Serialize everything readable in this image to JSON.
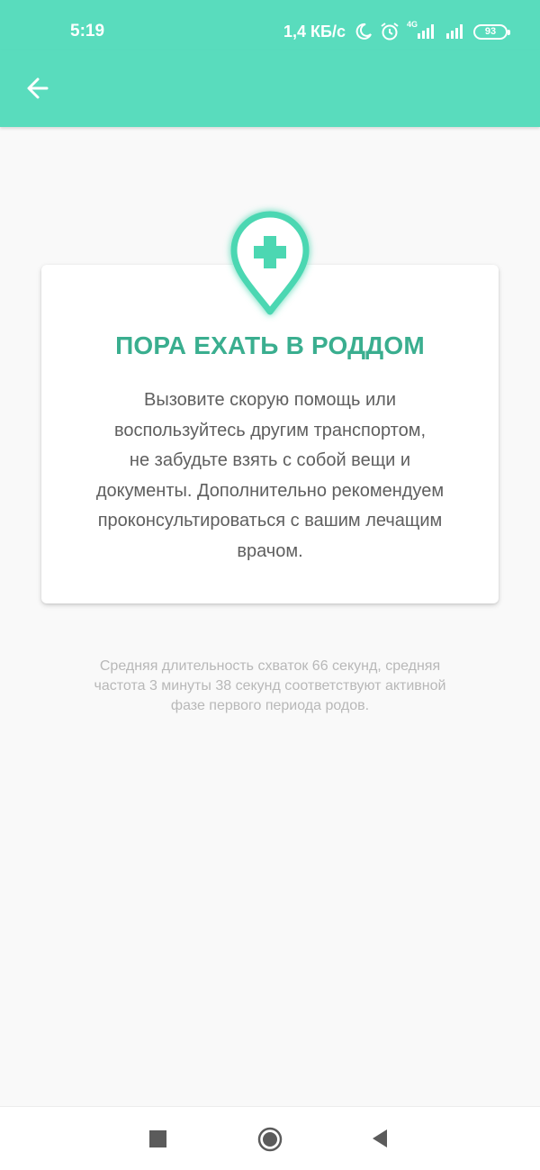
{
  "status_bar": {
    "time": "5:19",
    "network_speed": "1,4 КБ/с",
    "network_type": "4G",
    "battery_level": "93",
    "icons": [
      "moon-icon",
      "alarm-icon",
      "signal-4g-icon",
      "signal-icon",
      "battery-icon"
    ]
  },
  "app_bar": {
    "back_icon": "arrow-left-icon",
    "color": "#59dcbd"
  },
  "card": {
    "icon": "medical-location-pin-icon",
    "title": "ПОРА ЕХАТЬ В РОДДОМ",
    "body_lines": [
      "Вызовите скорую помощь или",
      "воспользуйтесь другим транспортом,",
      "не забудьте взять с собой вещи и",
      "документы. Дополнительно рекомендуем",
      "проконсультироваться с вашим лечащим",
      "врачом."
    ],
    "accent_color": "#3aae8f"
  },
  "footnote": {
    "lines": [
      "Средняя длительность схваток 66 секунд, средняя",
      "частота 3 минуты 38 секунд соответствуют активной",
      "фазе первого периода родов."
    ]
  },
  "nav_bar": {
    "icons": [
      "recent-apps-icon",
      "home-icon",
      "back-triangle-icon"
    ]
  }
}
